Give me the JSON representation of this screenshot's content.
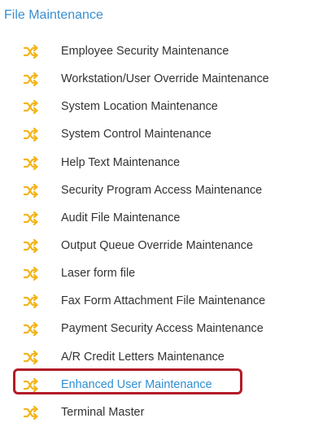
{
  "section": {
    "title": "File Maintenance"
  },
  "colors": {
    "title": "#3a8fd0",
    "icon": "#f2b51b",
    "item_text": "#333333",
    "highlighted_text": "#2f8fd2",
    "highlight_border": "#b31b27"
  },
  "items": [
    {
      "label": "Employee Security Maintenance",
      "icon": "shuffle-icon"
    },
    {
      "label": "Workstation/User Override Maintenance",
      "icon": "shuffle-icon"
    },
    {
      "label": "System Location Maintenance",
      "icon": "shuffle-icon"
    },
    {
      "label": "System Control Maintenance",
      "icon": "shuffle-icon"
    },
    {
      "label": "Help Text Maintenance",
      "icon": "shuffle-icon"
    },
    {
      "label": "Security Program Access Maintenance",
      "icon": "shuffle-icon"
    },
    {
      "label": "Audit File Maintenance",
      "icon": "shuffle-icon"
    },
    {
      "label": "Output Queue Override Maintenance",
      "icon": "shuffle-icon"
    },
    {
      "label": "Laser form file",
      "icon": "shuffle-icon"
    },
    {
      "label": "Fax Form Attachment File Maintenance",
      "icon": "shuffle-icon"
    },
    {
      "label": "Payment Security Access Maintenance",
      "icon": "shuffle-icon"
    },
    {
      "label": "A/R Credit Letters Maintenance",
      "icon": "shuffle-icon"
    },
    {
      "label": "Enhanced User Maintenance",
      "icon": "shuffle-icon",
      "highlighted": true
    },
    {
      "label": "Terminal Master",
      "icon": "shuffle-icon"
    }
  ]
}
